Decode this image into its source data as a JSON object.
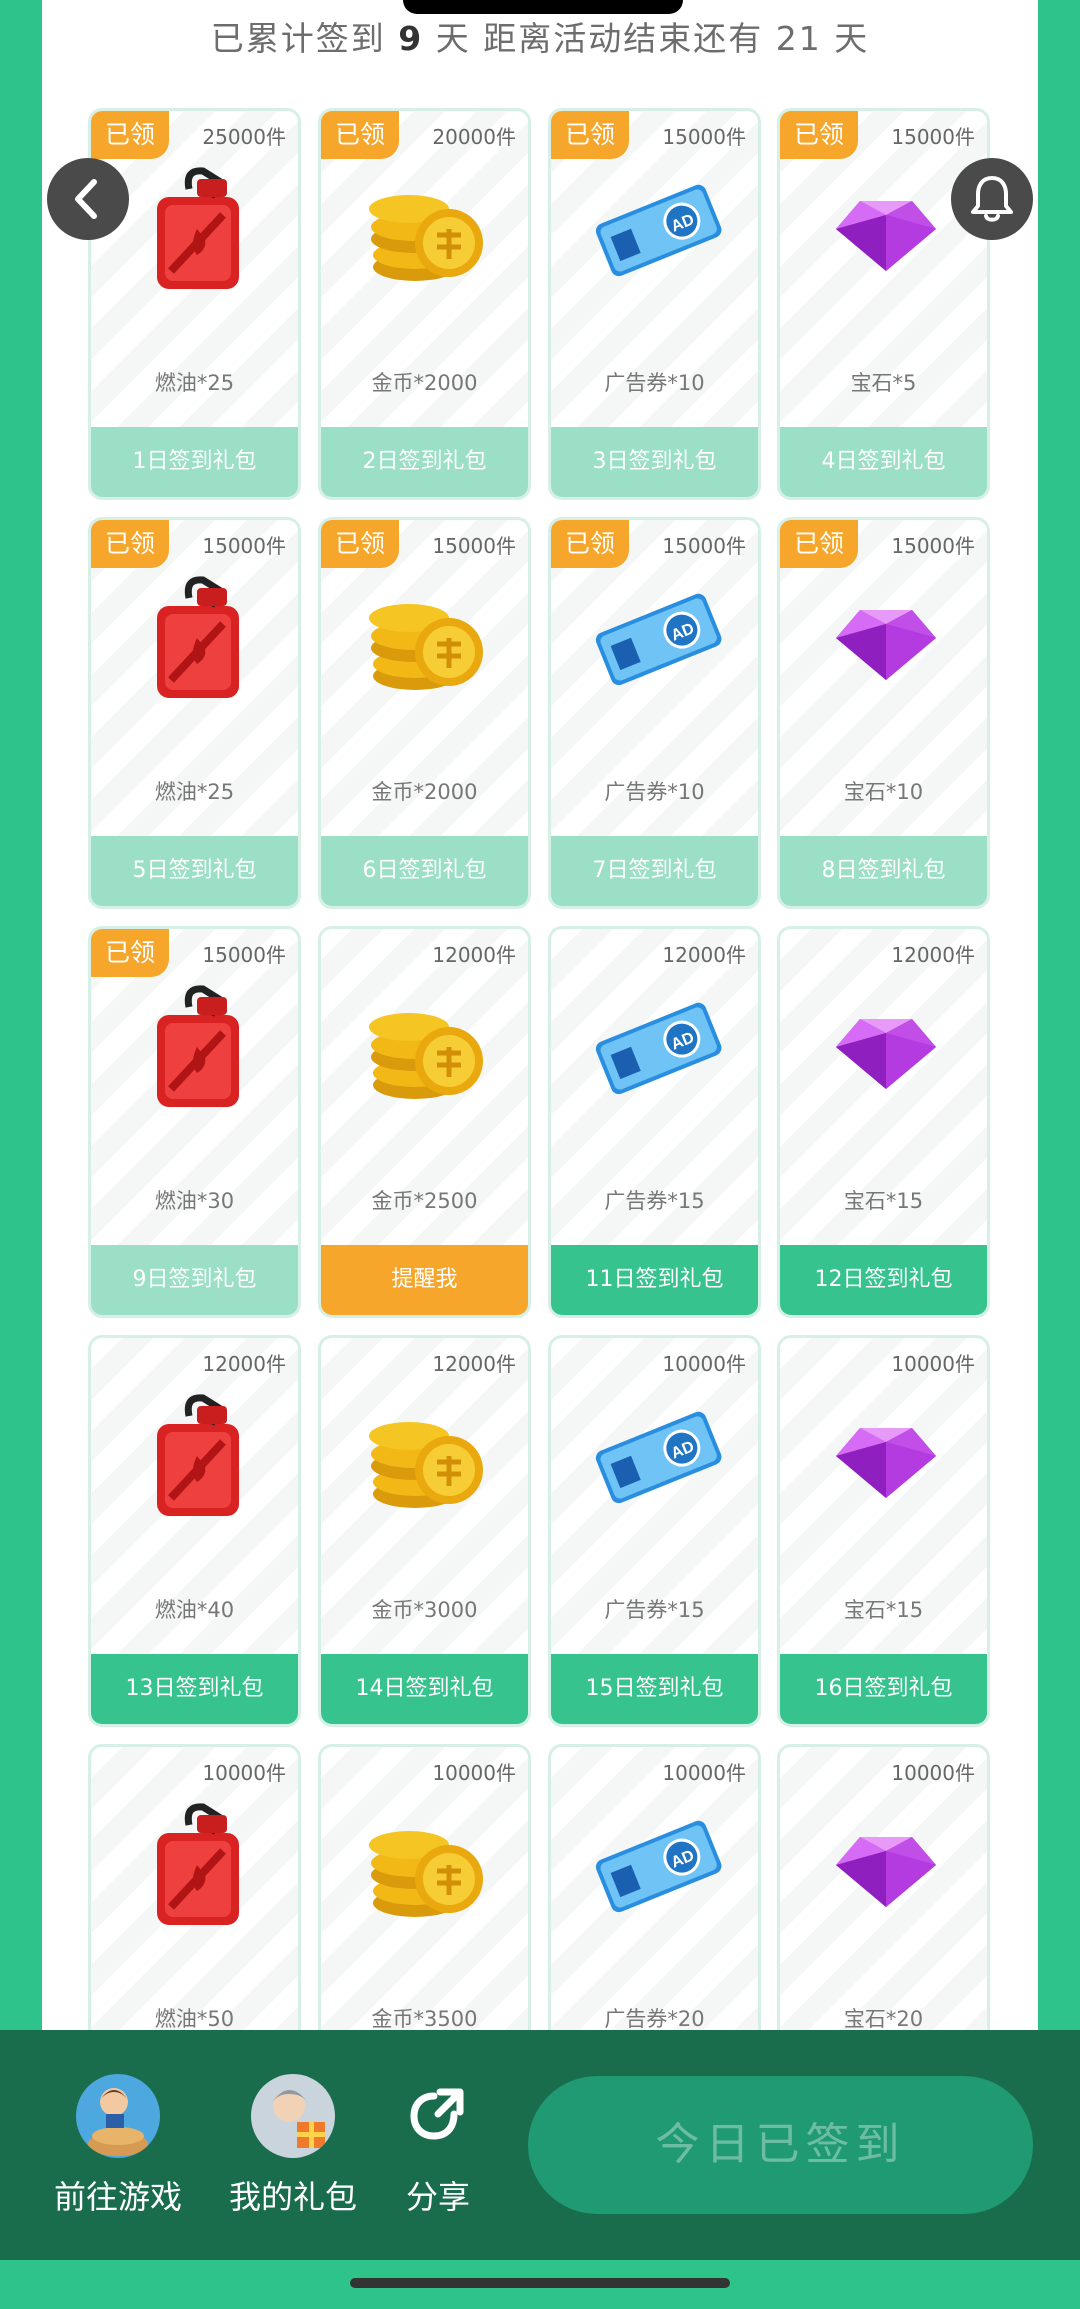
{
  "header": {
    "prefix": "已累计签到",
    "days": "9",
    "middle": "天  距离活动结束还有",
    "remaining": "21",
    "suffix": "天"
  },
  "icons": {
    "fuel": "fuel-can-icon",
    "coin": "gold-coins-icon",
    "ad": "ad-ticket-icon",
    "gem": "purple-gem-icon",
    "back": "chevron-left-icon",
    "bell": "bell-icon",
    "share": "share-icon"
  },
  "colors": {
    "accent": "#37c38d",
    "claimed": "#9adfc6",
    "remind": "#f6a62a",
    "bottom_bar": "#1a6d4c"
  },
  "claimed_label": "已领",
  "cards": [
    {
      "claimed": true,
      "stock": "25000件",
      "icon": "fuel",
      "name": "燃油*25",
      "button": "1日签到礼包",
      "state": "claimed"
    },
    {
      "claimed": true,
      "stock": "20000件",
      "icon": "coin",
      "name": "金币*2000",
      "button": "2日签到礼包",
      "state": "claimed"
    },
    {
      "claimed": true,
      "stock": "15000件",
      "icon": "ad",
      "name": "广告券*10",
      "button": "3日签到礼包",
      "state": "claimed"
    },
    {
      "claimed": true,
      "stock": "15000件",
      "icon": "gem",
      "name": "宝石*5",
      "button": "4日签到礼包",
      "state": "claimed"
    },
    {
      "claimed": true,
      "stock": "15000件",
      "icon": "fuel",
      "name": "燃油*25",
      "button": "5日签到礼包",
      "state": "claimed"
    },
    {
      "claimed": true,
      "stock": "15000件",
      "icon": "coin",
      "name": "金币*2000",
      "button": "6日签到礼包",
      "state": "claimed"
    },
    {
      "claimed": true,
      "stock": "15000件",
      "icon": "ad",
      "name": "广告券*10",
      "button": "7日签到礼包",
      "state": "claimed"
    },
    {
      "claimed": true,
      "stock": "15000件",
      "icon": "gem",
      "name": "宝石*10",
      "button": "8日签到礼包",
      "state": "claimed"
    },
    {
      "claimed": true,
      "stock": "15000件",
      "icon": "fuel",
      "name": "燃油*30",
      "button": "9日签到礼包",
      "state": "claimed"
    },
    {
      "claimed": false,
      "stock": "12000件",
      "icon": "coin",
      "name": "金币*2500",
      "button": "提醒我",
      "state": "remind"
    },
    {
      "claimed": false,
      "stock": "12000件",
      "icon": "ad",
      "name": "广告券*15",
      "button": "11日签到礼包",
      "state": "active"
    },
    {
      "claimed": false,
      "stock": "12000件",
      "icon": "gem",
      "name": "宝石*15",
      "button": "12日签到礼包",
      "state": "active"
    },
    {
      "claimed": false,
      "stock": "12000件",
      "icon": "fuel",
      "name": "燃油*40",
      "button": "13日签到礼包",
      "state": "active"
    },
    {
      "claimed": false,
      "stock": "12000件",
      "icon": "coin",
      "name": "金币*3000",
      "button": "14日签到礼包",
      "state": "active"
    },
    {
      "claimed": false,
      "stock": "10000件",
      "icon": "ad",
      "name": "广告券*15",
      "button": "15日签到礼包",
      "state": "active"
    },
    {
      "claimed": false,
      "stock": "10000件",
      "icon": "gem",
      "name": "宝石*15",
      "button": "16日签到礼包",
      "state": "active"
    },
    {
      "claimed": false,
      "stock": "10000件",
      "icon": "fuel",
      "name": "燃油*50",
      "button": "",
      "state": "hidden"
    },
    {
      "claimed": false,
      "stock": "10000件",
      "icon": "coin",
      "name": "金币*3500",
      "button": "",
      "state": "hidden"
    },
    {
      "claimed": false,
      "stock": "10000件",
      "icon": "ad",
      "name": "广告券*20",
      "button": "",
      "state": "hidden"
    },
    {
      "claimed": false,
      "stock": "10000件",
      "icon": "gem",
      "name": "宝石*20",
      "button": "",
      "state": "hidden"
    }
  ],
  "bottom": {
    "go_game": "前往游戏",
    "my_gifts": "我的礼包",
    "share": "分享",
    "checkin": "今日已签到"
  }
}
